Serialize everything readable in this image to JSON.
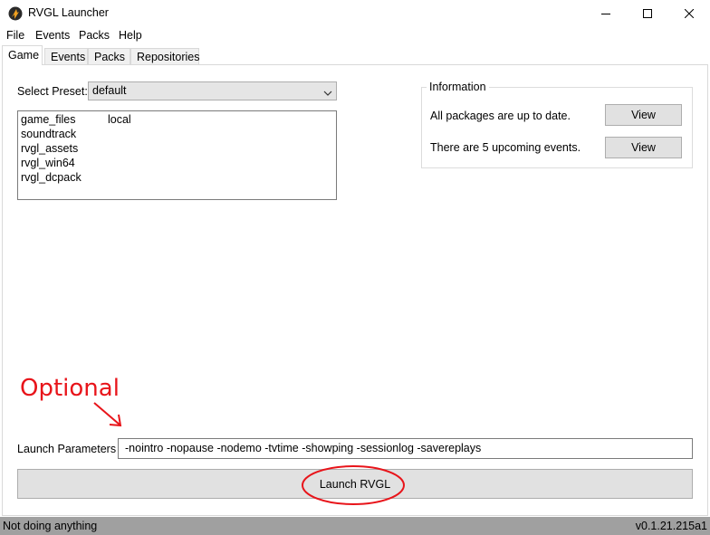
{
  "window": {
    "title": "RVGL Launcher",
    "icon": "rvgl-logo-icon"
  },
  "menu": {
    "items": [
      "File",
      "Events",
      "Packs",
      "Help"
    ]
  },
  "tabs": {
    "items": [
      "Game",
      "Events",
      "Packs",
      "Repositories"
    ],
    "active": "Game"
  },
  "game": {
    "preset_label": "Select Preset:",
    "preset_value": "default",
    "packages": [
      {
        "name": "game_files",
        "source": "local"
      },
      {
        "name": "soundtrack",
        "source": ""
      },
      {
        "name": "rvgl_assets",
        "source": ""
      },
      {
        "name": "rvgl_win64",
        "source": ""
      },
      {
        "name": "rvgl_dcpack",
        "source": ""
      }
    ],
    "launch_params_label": "Launch Parameters",
    "launch_params_value": "-nointro -nopause -nodemo -tvtime -showping -sessionlog -savereplays",
    "launch_button": "Launch RVGL"
  },
  "information": {
    "title": "Information",
    "packages_status": "All packages are up to date.",
    "events_status": "There are 5 upcoming events.",
    "view_label": "View"
  },
  "annotation": {
    "text": "Optional",
    "color": "#e8141a"
  },
  "status": {
    "left": "Not doing anything",
    "right": "v0.1.21.215a1"
  }
}
